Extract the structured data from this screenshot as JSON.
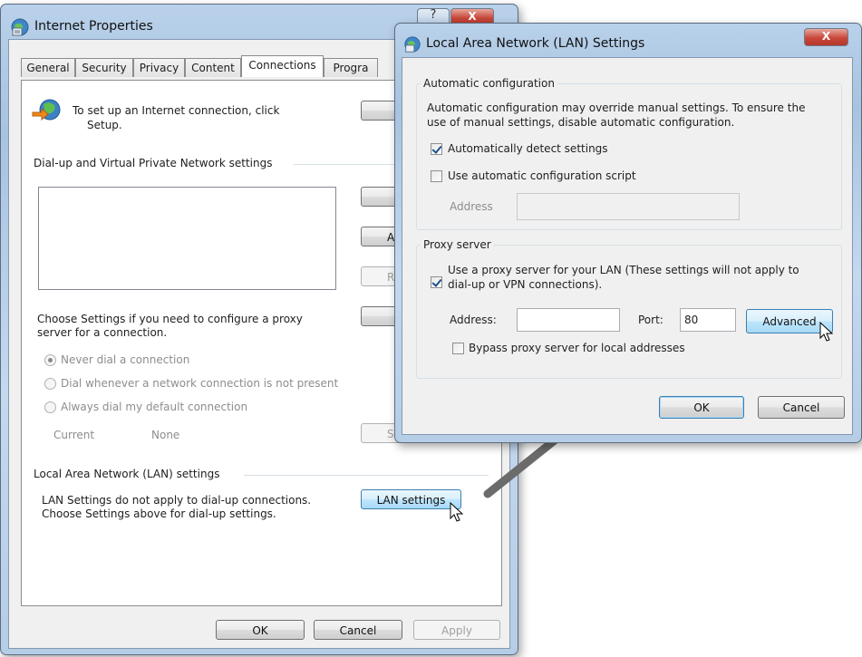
{
  "internet_properties": {
    "title": "Internet Properties",
    "help_glyph": "?",
    "close_glyph": "X",
    "tabs": [
      "General",
      "Security",
      "Privacy",
      "Content",
      "Connections",
      "Progra"
    ],
    "selected_tab": "Connections",
    "setup_text_line1": "To set up an Internet connection, click",
    "setup_text_line2": "Setup.",
    "dialup_group_title": "Dial-up and Virtual Private Network settings",
    "side_button_a": "A",
    "side_button_r": "R",
    "proxy_hint_line1": "Choose Settings if you need to configure a proxy",
    "proxy_hint_line2": "server for a connection.",
    "radio_never": "Never dial a connection",
    "radio_whenever": "Dial whenever a network connection is not present",
    "radio_always": "Always dial my default connection",
    "current_label": "Current",
    "current_value": "None",
    "settings_button_s": "S",
    "lan_group_title": "Local Area Network (LAN) settings",
    "lan_text_line1": "LAN Settings do not apply to dial-up connections.",
    "lan_text_line2": "Choose Settings above for dial-up settings.",
    "lan_settings_button": "LAN settings",
    "ok": "OK",
    "cancel": "Cancel",
    "apply": "Apply"
  },
  "lan_dialog": {
    "title": "Local Area Network (LAN) Settings",
    "close_glyph": "X",
    "auto_group_title": "Automatic configuration",
    "auto_desc_line1": "Automatic configuration may override manual settings.  To ensure the",
    "auto_desc_line2": "use of manual settings, disable automatic configuration.",
    "auto_detect_label": "Automatically detect settings",
    "auto_detect_checked": true,
    "auto_script_label": "Use automatic configuration script",
    "auto_script_checked": false,
    "script_address_label": "Address",
    "script_address_value": "",
    "proxy_group_title": "Proxy server",
    "use_proxy_line1": "Use a proxy server for your LAN (These settings will not apply to",
    "use_proxy_line2": "dial-up or VPN connections).",
    "use_proxy_checked": true,
    "address_label": "Address:",
    "address_value": "",
    "port_label": "Port:",
    "port_value": "80",
    "advanced_button": "Advanced",
    "bypass_label": "Bypass proxy server for local addresses",
    "bypass_checked": false,
    "ok": "OK",
    "cancel": "Cancel"
  },
  "colors": {
    "dialog_bg": "#f0f0f0",
    "frame_blue": "#b9d1ea",
    "close_red": "#c8473a",
    "arrow_gray": "#6b6b6b",
    "hot_button": "#bee6fd"
  },
  "icons": {
    "app": "internet-options-icon",
    "globe": "globe-setup-icon",
    "cursor": "mouse-pointer-icon",
    "arrow": "callout-arrow"
  }
}
